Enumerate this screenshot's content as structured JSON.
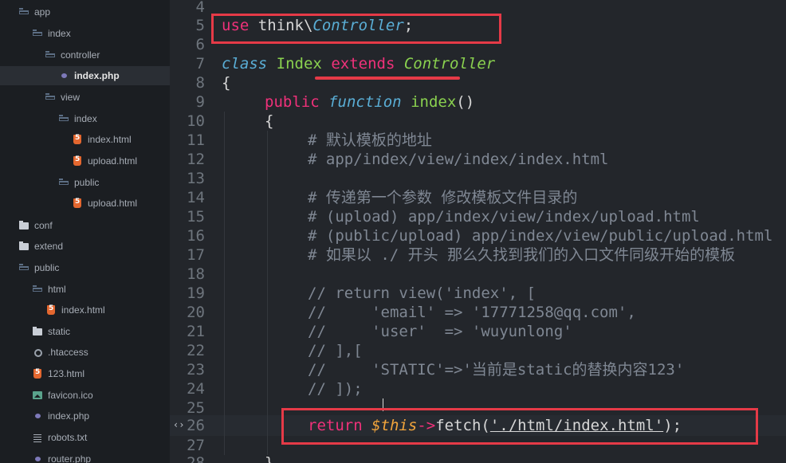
{
  "sidebar": {
    "items": [
      {
        "label": "app",
        "icon": "folder-open-icon"
      },
      {
        "label": "index",
        "icon": "folder-open-icon"
      },
      {
        "label": "controller",
        "icon": "folder-open-icon"
      },
      {
        "label": "index.php",
        "icon": "php-icon"
      },
      {
        "label": "view",
        "icon": "folder-open-icon"
      },
      {
        "label": "index",
        "icon": "folder-open-icon"
      },
      {
        "label": "index.html",
        "icon": "html-icon"
      },
      {
        "label": "upload.html",
        "icon": "html-icon"
      },
      {
        "label": "public",
        "icon": "folder-open-icon"
      },
      {
        "label": "upload.html",
        "icon": "html-icon"
      },
      {
        "label": "conf",
        "icon": "folder-solid-icon"
      },
      {
        "label": "extend",
        "icon": "folder-solid-icon"
      },
      {
        "label": "public",
        "icon": "folder-open-icon"
      },
      {
        "label": "html",
        "icon": "folder-open-icon"
      },
      {
        "label": "index.html",
        "icon": "html-icon"
      },
      {
        "label": "static",
        "icon": "folder-solid-icon"
      },
      {
        "label": ".htaccess",
        "icon": "gear-icon"
      },
      {
        "label": "123.html",
        "icon": "html-icon"
      },
      {
        "label": "favicon.ico",
        "icon": "image-icon"
      },
      {
        "label": "index.php",
        "icon": "php-icon"
      },
      {
        "label": "robots.txt",
        "icon": "text-icon"
      },
      {
        "label": "router.php",
        "icon": "php-icon"
      }
    ]
  },
  "editor": {
    "line_numbers": [
      "4",
      "5",
      "6",
      "7",
      "8",
      "9",
      "10",
      "11",
      "12",
      "13",
      "14",
      "15",
      "16",
      "17",
      "18",
      "19",
      "20",
      "21",
      "22",
      "23",
      "24",
      "25",
      "26",
      "27",
      "28"
    ],
    "lines": {
      "l5": {
        "kw": "use",
        "rest": " think\\",
        "ctrl": "Controller",
        "semi": ";"
      },
      "l7": {
        "class": "class",
        "sp1": " ",
        "name": "Index",
        "sp2": " ",
        "extends": "extends",
        "sp3": " ",
        "parent": "Controller"
      },
      "l8": "{",
      "l9": {
        "public": "public",
        "function": "function",
        "name": "index",
        "parens": "()"
      },
      "l10": "{",
      "l11": "# 默认模板的地址",
      "l12": "# app/index/view/index/index.html",
      "l14": "# 传递第一个参数 修改模板文件目录的",
      "l15": "# (upload) app/index/view/index/upload.html",
      "l16": "# (public/upload) app/index/view/public/upload.html",
      "l17": "# 如果以 ./ 开头 那么久找到我们的入口文件同级开始的模板",
      "l19": "// return view('index', [",
      "l20": "//     'email' => '17771258@qq.com',",
      "l21": "//     'user'  => 'wuyunlong'",
      "l22": "// ],[",
      "l23": "//     'STATIC'=>'当前是static的替换内容123'",
      "l24": "// ]);",
      "l26": {
        "ret": "return",
        "this": "$this",
        "arrow": "->",
        "fn": "fetch",
        "open": "(",
        "str": "'./html/index.html'",
        "close": ");"
      },
      "l28": "}"
    },
    "fold_glyph": "‹›",
    "accent": "#e53a47"
  }
}
